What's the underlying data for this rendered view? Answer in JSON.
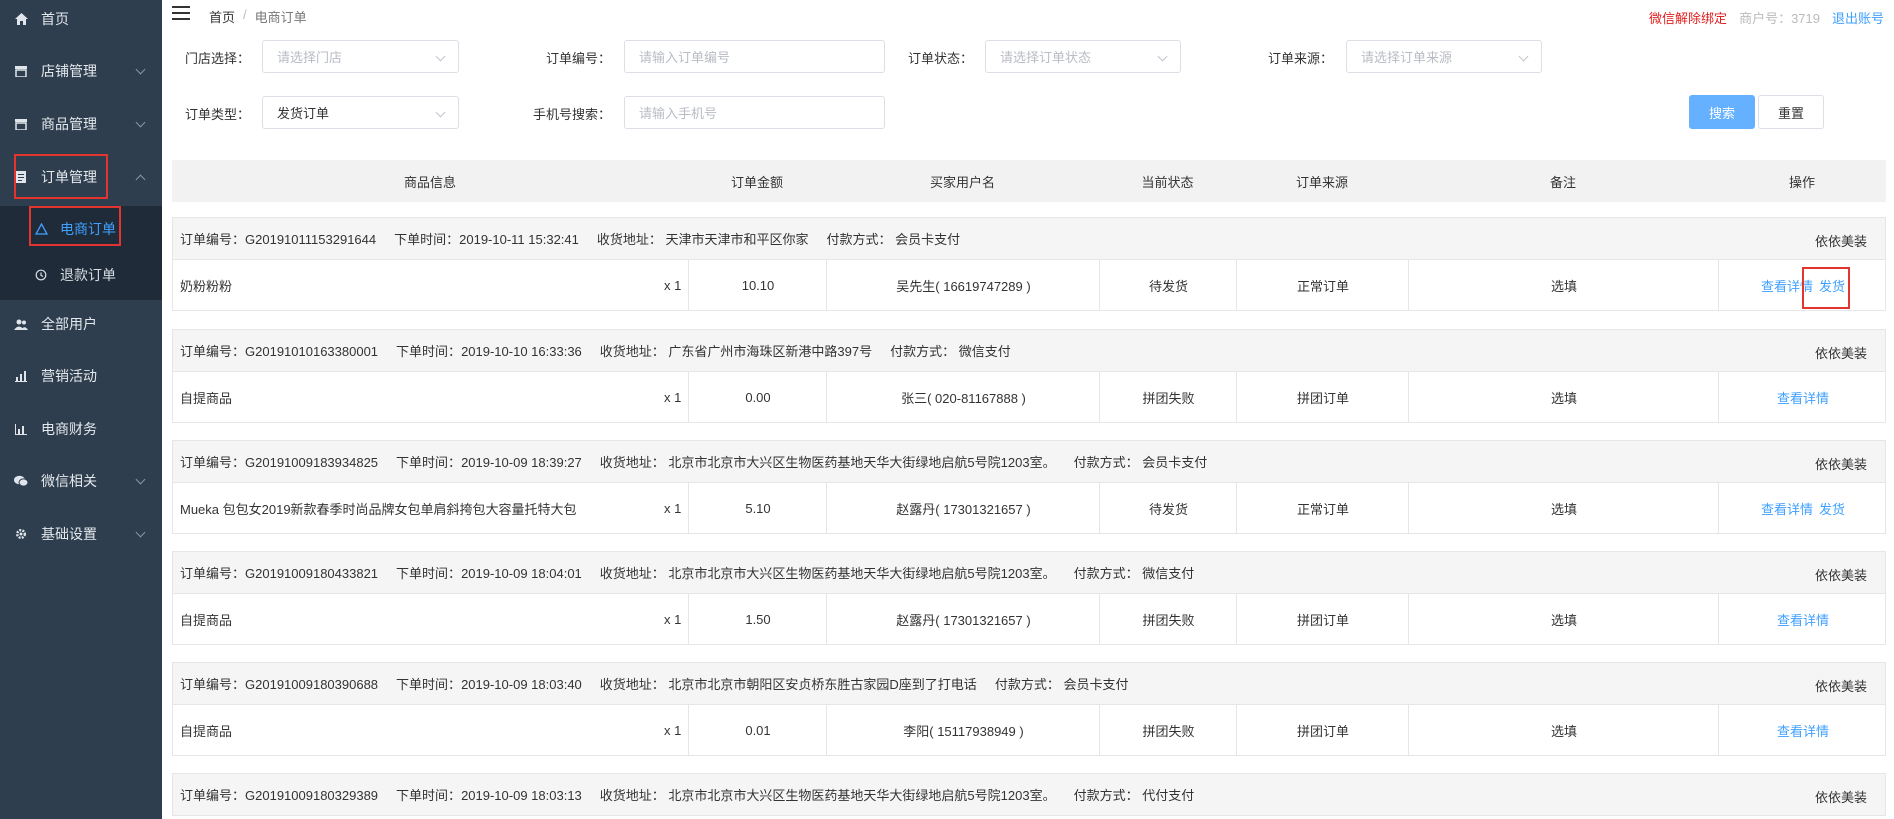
{
  "sidebar": {
    "items": [
      {
        "label": "首页",
        "icon": "home-icon"
      },
      {
        "label": "店铺管理",
        "icon": "store-icon"
      },
      {
        "label": "商品管理",
        "icon": "goods-icon"
      },
      {
        "label": "订单管理",
        "icon": "order-icon"
      },
      {
        "label": "全部用户",
        "icon": "users-icon"
      },
      {
        "label": "营销活动",
        "icon": "marketing-chart-icon"
      },
      {
        "label": "电商财务",
        "icon": "finance-chart-icon"
      },
      {
        "label": "微信相关",
        "icon": "wechat-icon"
      },
      {
        "label": "基础设置",
        "icon": "gear-icon"
      }
    ],
    "sub_items": [
      {
        "label": "电商订单",
        "icon": "triangle-icon",
        "active": true
      },
      {
        "label": "退款订单",
        "icon": "refund-icon"
      }
    ]
  },
  "header": {
    "breadcrumb_home": "首页",
    "breadcrumb_sep": "/",
    "breadcrumb_current": "电商订单",
    "unbind": "微信解除绑定",
    "merchant": "商户号：3719",
    "logout": "退出账号"
  },
  "filters": {
    "store_label": "门店选择：",
    "store_placeholder": "请选择门店",
    "order_no_label": "订单编号：",
    "order_no_placeholder": "请输入订单编号",
    "status_label": "订单状态：",
    "status_placeholder": "请选择订单状态",
    "source_label": "订单来源：",
    "source_placeholder": "请选择订单来源",
    "type_label": "订单类型：",
    "type_value": "发货订单",
    "phone_label": "手机号搜索：",
    "phone_placeholder": "请输入手机号",
    "search_button": "搜索",
    "reset_button": "重置"
  },
  "table": {
    "headers": [
      "商品信息",
      "订单金额",
      "买家用户名",
      "当前状态",
      "订单来源",
      "备注",
      "操作"
    ],
    "labels": {
      "order_no": "订单编号：",
      "time": "下单时间：",
      "address": "收货地址：",
      "pay": "付款方式："
    },
    "orders": [
      {
        "no": "G20191011153291644",
        "time": "2019-10-11 15:32:41",
        "address": "天津市天津市和平区你家",
        "pay": "会员卡支付",
        "store": "依依美装",
        "product": "奶粉粉粉",
        "qty": "x 1",
        "amount": "10.10",
        "buyer": "吴先生( 16619747289 )",
        "status": "待发货",
        "source": "正常订单",
        "remark": "选填",
        "detail": "查看详情",
        "ship": "发货"
      },
      {
        "no": "G20191010163380001",
        "time": "2019-10-10 16:33:36",
        "address": "广东省广州市海珠区新港中路397号",
        "pay": "微信支付",
        "store": "依依美装",
        "product": "自提商品",
        "qty": "x 1",
        "amount": "0.00",
        "buyer": "张三( 020-81167888 )",
        "status": "拼团失败",
        "source": "拼团订单",
        "remark": "选填",
        "detail": "查看详情",
        "ship": ""
      },
      {
        "no": "G20191009183934825",
        "time": "2019-10-09 18:39:27",
        "address": "北京市北京市大兴区生物医药基地天华大街绿地启航5号院1203室。",
        "pay": "会员卡支付",
        "store": "依依美装",
        "product": "Mueka 包包女2019新款春季时尚品牌女包单肩斜挎包大容量托特大包",
        "qty": "x 1",
        "amount": "5.10",
        "buyer": "赵露丹( 17301321657 )",
        "status": "待发货",
        "source": "正常订单",
        "remark": "选填",
        "detail": "查看详情",
        "ship": "发货"
      },
      {
        "no": "G20191009180433821",
        "time": "2019-10-09 18:04:01",
        "address": "北京市北京市大兴区生物医药基地天华大街绿地启航5号院1203室。",
        "pay": "微信支付",
        "store": "依依美装",
        "product": "自提商品",
        "qty": "x 1",
        "amount": "1.50",
        "buyer": "赵露丹( 17301321657 )",
        "status": "拼团失败",
        "source": "拼团订单",
        "remark": "选填",
        "detail": "查看详情",
        "ship": ""
      },
      {
        "no": "G20191009180390688",
        "time": "2019-10-09 18:03:40",
        "address": "北京市北京市朝阳区安贞桥东胜古家园D座到了打电话",
        "pay": "会员卡支付",
        "store": "依依美装",
        "product": "自提商品",
        "qty": "x 1",
        "amount": "0.01",
        "buyer": "李阳( 15117938949 )",
        "status": "拼团失败",
        "source": "拼团订单",
        "remark": "选填",
        "detail": "查看详情",
        "ship": ""
      },
      {
        "no": "G20191009180329389",
        "time": "2019-10-09 18:03:13",
        "address": "北京市北京市大兴区生物医药基地天华大街绿地启航5号院1203室。",
        "pay": "代付支付",
        "store": "依依美装"
      }
    ]
  },
  "colors": {
    "sidebar_bg": "#2f3e4e",
    "submenu_bg": "#1f2b38",
    "accent": "#3fa0ff",
    "highlight_box": "#e3342f",
    "unbind_text": "#e02020"
  }
}
